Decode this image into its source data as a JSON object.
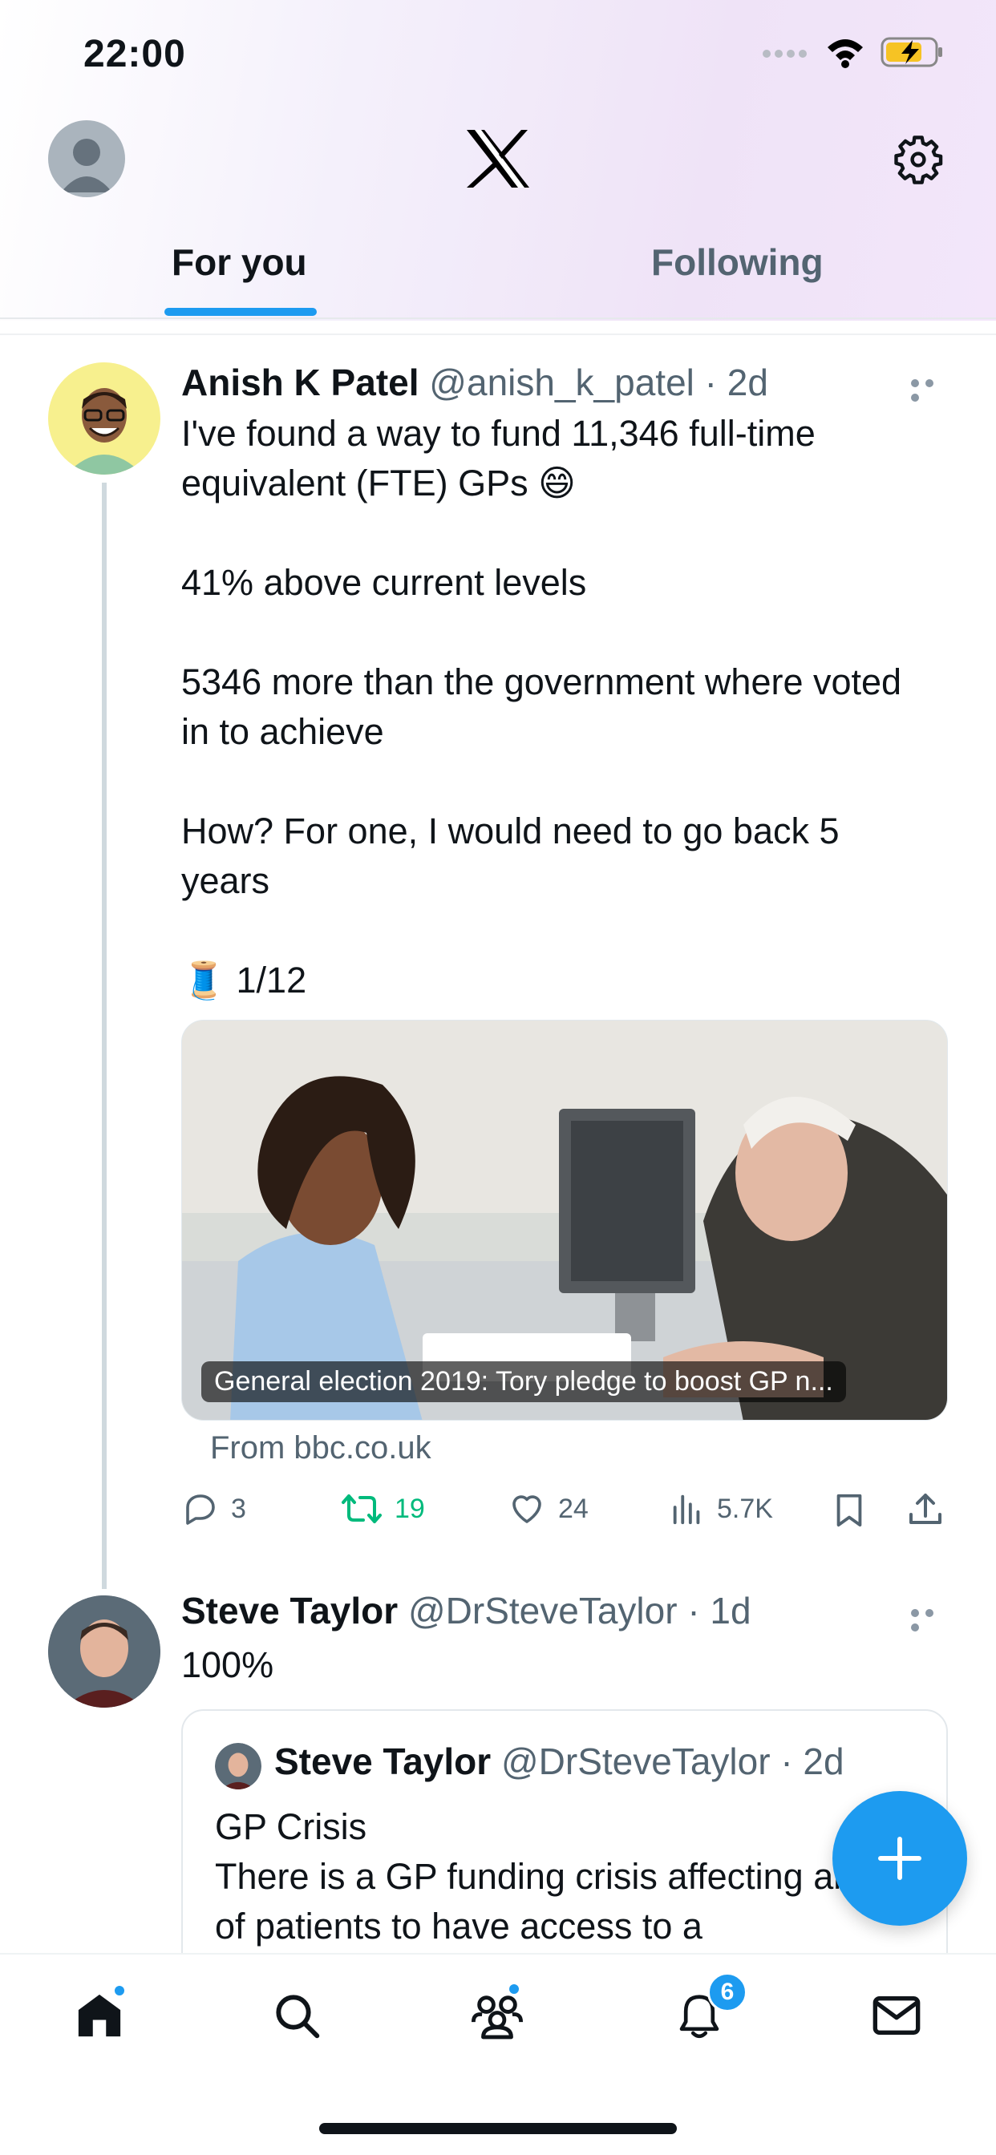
{
  "status_bar": {
    "time": "22:00"
  },
  "tabs": [
    {
      "label": "For you"
    },
    {
      "label": "Following"
    }
  ],
  "tweets": [
    {
      "name": "Anish K Patel",
      "handle": "@anish_k_patel",
      "time": "· 2d",
      "text": "I've found a way to fund 11,346 full-time equivalent (FTE) GPs 😄\n\n41% above current levels\n\n5346 more than the government where voted in to achieve\n\nHow? For one, I would need to go back 5 years\n\n🧵 1/12",
      "card": {
        "caption": "General election 2019: Tory pledge to boost GP n...",
        "source": "From bbc.co.uk"
      },
      "actions": {
        "replies": "3",
        "retweets": "19",
        "likes": "24",
        "views": "5.7K"
      }
    },
    {
      "name": "Steve Taylor",
      "handle": "@DrSteveTaylor",
      "time": "· 1d",
      "text": "100%",
      "quote": {
        "name": "Steve Taylor",
        "handle": "@DrSteveTaylor",
        "time": "· 2d",
        "text": "GP Crisis\nThere is a GP funding crisis affecting ability of patients to have access to a"
      }
    }
  ],
  "nav": {
    "notifications_badge": "6"
  },
  "colors": {
    "accent": "#1d9bf0",
    "retweet": "#00ba7c",
    "secondary": "#536471"
  }
}
